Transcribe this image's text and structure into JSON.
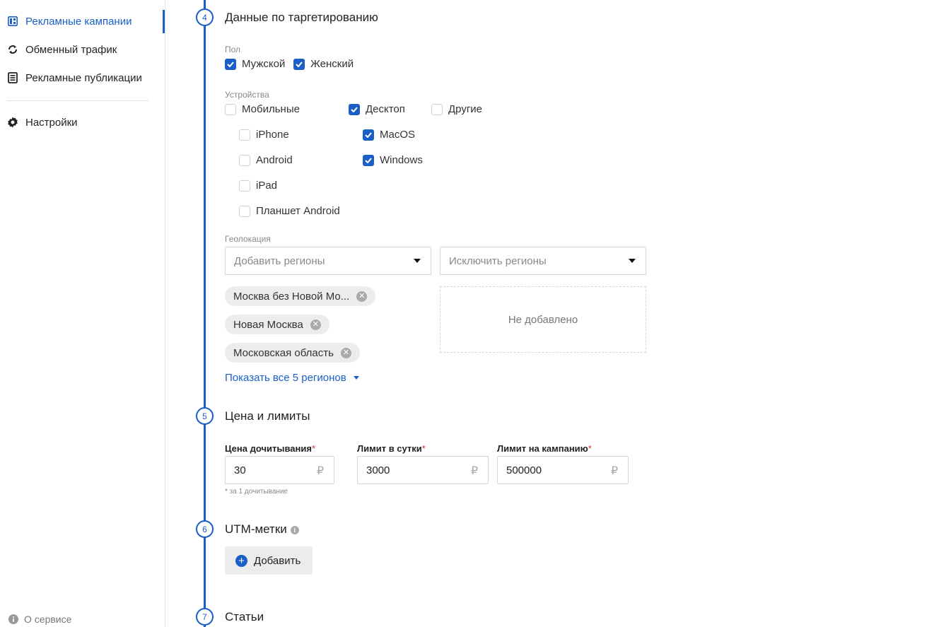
{
  "sidebar": {
    "items": [
      {
        "label": "Рекламные кампании",
        "icon": "dashboard-icon",
        "active": true
      },
      {
        "label": "Обменный трафик",
        "icon": "exchange-icon",
        "active": false
      },
      {
        "label": "Рекламные публикации",
        "icon": "document-icon",
        "active": false
      },
      {
        "label": "Настройки",
        "icon": "gear-icon",
        "active": false
      }
    ],
    "about": "О сервисе"
  },
  "colors": {
    "accent": "#1a5fc8",
    "required": "#d9342b"
  },
  "steps": [
    {
      "number": "4",
      "title": "Данные по таргетированию"
    },
    {
      "number": "5",
      "title": "Цена и лимиты"
    },
    {
      "number": "6",
      "title": "UTM-метки"
    },
    {
      "number": "7",
      "title": "Статьи"
    }
  ],
  "targeting": {
    "gender_label": "Пол",
    "gender": [
      {
        "label": "Мужской",
        "checked": true
      },
      {
        "label": "Женский",
        "checked": true
      }
    ],
    "devices_label": "Устройства",
    "devices": {
      "mobile": {
        "label": "Мобильные",
        "checked": false
      },
      "desktop": {
        "label": "Десктоп",
        "checked": true
      },
      "other": {
        "label": "Другие",
        "checked": false
      },
      "mobile_sub": [
        {
          "label": "iPhone",
          "checked": false
        },
        {
          "label": "Android",
          "checked": false
        },
        {
          "label": "iPad",
          "checked": false
        },
        {
          "label": "Планшет Android",
          "checked": false
        }
      ],
      "desktop_sub": [
        {
          "label": "MacOS",
          "checked": true
        },
        {
          "label": "Windows",
          "checked": true
        }
      ]
    },
    "geo_label": "Геолокация",
    "add_regions_placeholder": "Добавить регионы",
    "exclude_regions_placeholder": "Исключить регионы",
    "regions": [
      "Москва без Новой Мо...",
      "Новая Москва",
      "Московская область"
    ],
    "excluded_empty": "Не добавлено",
    "show_all": "Показать все 5 регионов"
  },
  "pricing": {
    "price_label": "Цена дочитывания",
    "price_value": "30",
    "price_hint": "* за 1 дочитывание",
    "daily_label": "Лимит в сутки",
    "daily_value": "3000",
    "campaign_label": "Лимит на кампанию",
    "campaign_value": "500000",
    "currency": "₽",
    "required_mark": "*"
  },
  "utm": {
    "add_label": "Добавить",
    "info_icon": "info-icon"
  }
}
